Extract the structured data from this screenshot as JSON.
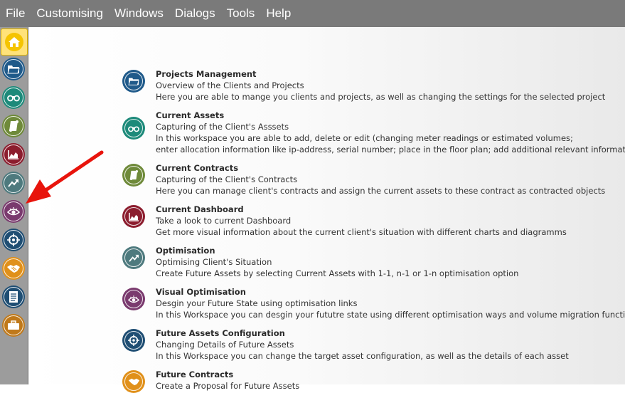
{
  "menubar": {
    "items": [
      "File",
      "Customising",
      "Windows",
      "Dialogs",
      "Tools",
      "Help"
    ]
  },
  "sidebar": {
    "buttons": [
      {
        "name": "home",
        "icon": "home-icon",
        "color": "#f5c400"
      },
      {
        "name": "projects",
        "icon": "folder-icon",
        "color": "#1f5a8a"
      },
      {
        "name": "current-assets",
        "icon": "binoculars-icon",
        "color": "#1d8a7a"
      },
      {
        "name": "current-contracts",
        "icon": "scroll-icon",
        "color": "#6f8a3a"
      },
      {
        "name": "current-dashboard",
        "icon": "chart-icon",
        "color": "#8c1d2e"
      },
      {
        "name": "optimisation",
        "icon": "trend-icon",
        "color": "#4e7a7e"
      },
      {
        "name": "visual-optimisation",
        "icon": "eye-icon",
        "color": "#7a3a6e"
      },
      {
        "name": "future-assets-configuration",
        "icon": "target-icon",
        "color": "#1f4e73"
      },
      {
        "name": "future-contracts",
        "icon": "handshake-icon",
        "color": "#e0901a"
      },
      {
        "name": "reports",
        "icon": "document-icon",
        "color": "#1f4e73"
      },
      {
        "name": "portfolio",
        "icon": "briefcase-icon",
        "color": "#c0791a"
      }
    ]
  },
  "workspaces": [
    {
      "title": "Projects Management",
      "lines": [
        "Overview of the Clients and Projects",
        "Here you are able to mange you clients and projects, as well as changing the settings for the selected project"
      ],
      "icon": "folder-icon",
      "color": "#1f5a8a"
    },
    {
      "title": "Current Assets",
      "lines": [
        "Capturing of the Client's Asssets",
        "In this workspace you are able to add, delete or edit (changing meter readings or estimated volumes;",
        "enter allocation information like ip-address, serial number; place in the floor plan; add additional relevant information)"
      ],
      "icon": "binoculars-icon",
      "color": "#1d8a7a"
    },
    {
      "title": "Current Contracts",
      "lines": [
        "Capturing of the Client's Contracts",
        "Here you can manage client's contracts and assign the current assets to these contract as contracted objects"
      ],
      "icon": "scroll-icon",
      "color": "#6f8a3a"
    },
    {
      "title": "Current Dashboard",
      "lines": [
        "Take a look to current Dashboard",
        "Get more visual information about the current client's situation with different charts and diagramms"
      ],
      "icon": "chart-icon",
      "color": "#8c1d2e"
    },
    {
      "title": "Optimisation",
      "lines": [
        "Optimising Client's Situation",
        "Create Future Assets by selecting Current Assets with 1-1, n-1 or 1-n optimisation option"
      ],
      "icon": "trend-icon",
      "color": "#4e7a7e"
    },
    {
      "title": "Visual Optimisation",
      "lines": [
        "Desgin your Future State using optimisation links",
        "In this Workspace you can desgin your fututre state using different optimisation ways and volume migration functionality"
      ],
      "icon": "eye-icon",
      "color": "#7a3a6e"
    },
    {
      "title": "Future Assets Configuration",
      "lines": [
        "Changing Details of Future Assets",
        "In this Workspace you can change the target asset configuration, as well as the details of each asset"
      ],
      "icon": "target-icon",
      "color": "#1f4e73"
    },
    {
      "title": "Future Contracts",
      "lines": [
        "Create a Proposal for Future Assets"
      ],
      "icon": "handshake-icon",
      "color": "#e0901a"
    }
  ],
  "annotation": {
    "arrow_color": "#e8140c"
  }
}
